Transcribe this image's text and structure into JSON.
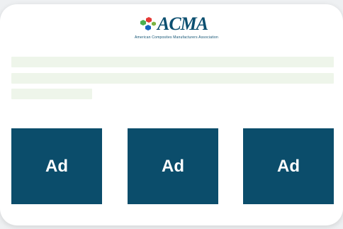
{
  "logo": {
    "wordmark": "ACMA",
    "tagline": "American Composites Manufacturers Association",
    "hex_colors": [
      "#4caf50",
      "#e53935",
      "#1565c0"
    ],
    "brand_color": "#0c4f70"
  },
  "content": {
    "placeholder_color": "#eef5ea"
  },
  "ads": [
    {
      "label": "Ad"
    },
    {
      "label": "Ad"
    },
    {
      "label": "Ad"
    }
  ],
  "colors": {
    "ad_background": "#0b4d6b",
    "card_background": "#ffffff"
  }
}
